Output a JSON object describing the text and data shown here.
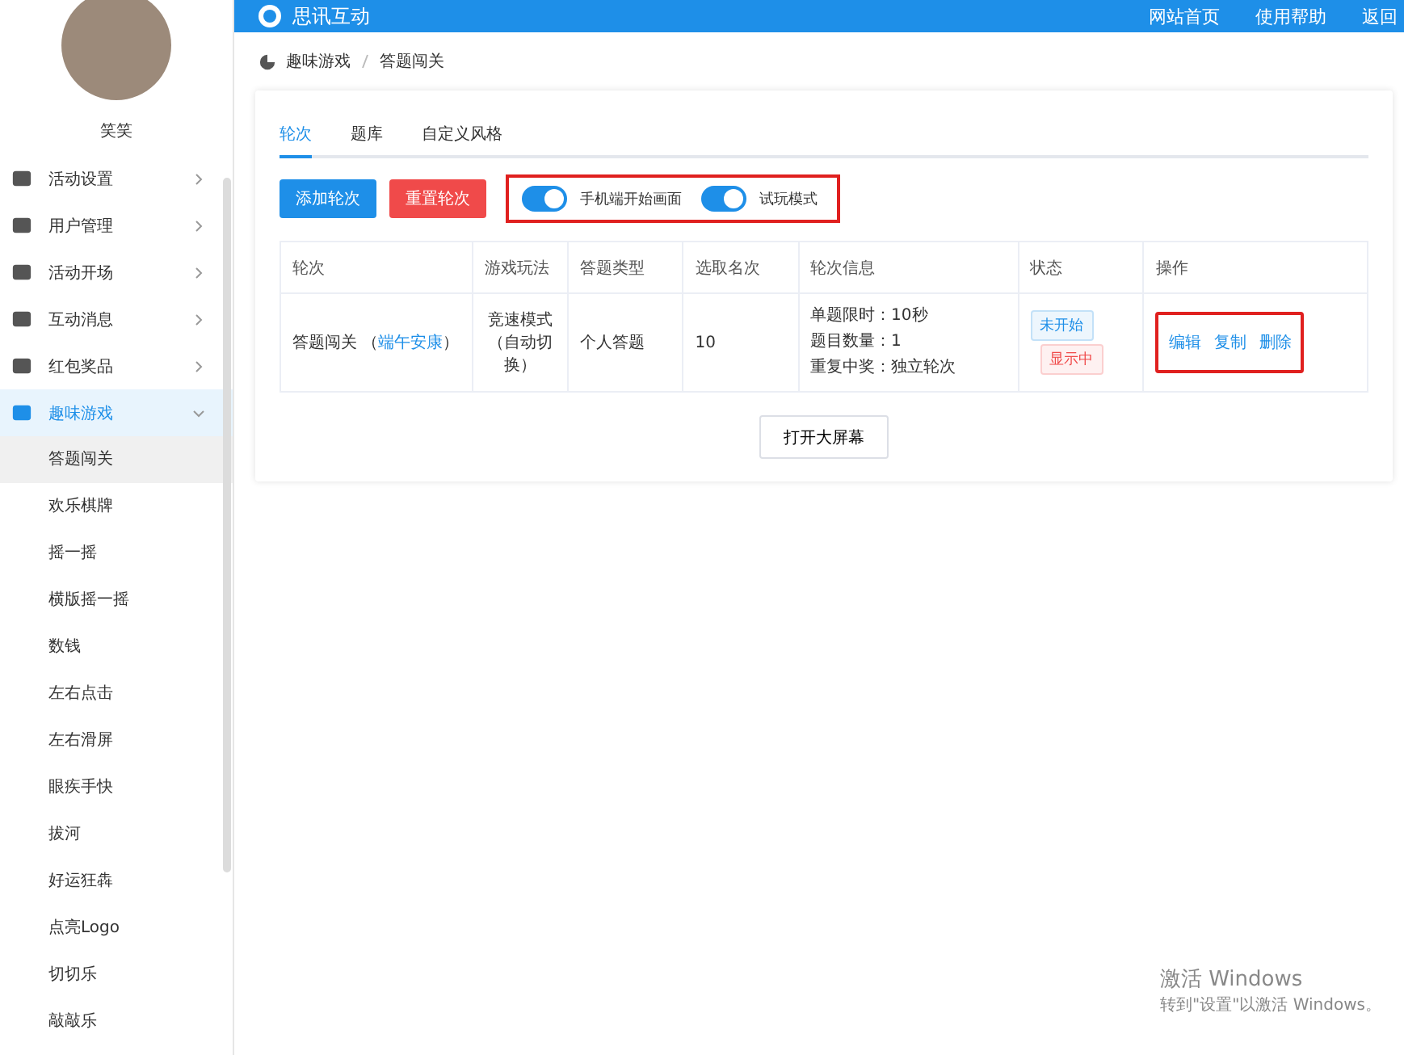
{
  "sidebar": {
    "user_name": "笑笑",
    "items": [
      {
        "label": "活动设置",
        "expanded": false,
        "selected": false
      },
      {
        "label": "用户管理",
        "expanded": false,
        "selected": false
      },
      {
        "label": "活动开场",
        "expanded": false,
        "selected": false
      },
      {
        "label": "互动消息",
        "expanded": false,
        "selected": false
      },
      {
        "label": "红包奖品",
        "expanded": false,
        "selected": false
      },
      {
        "label": "趣味游戏",
        "expanded": true,
        "selected": true,
        "children": [
          {
            "label": "答题闯关",
            "selected": true
          },
          {
            "label": "欢乐棋牌",
            "selected": false
          },
          {
            "label": "摇一摇",
            "selected": false
          },
          {
            "label": "横版摇一摇",
            "selected": false
          },
          {
            "label": "数钱",
            "selected": false
          },
          {
            "label": "左右点击",
            "selected": false
          },
          {
            "label": "左右滑屏",
            "selected": false
          },
          {
            "label": "眼疾手快",
            "selected": false
          },
          {
            "label": "拔河",
            "selected": false
          },
          {
            "label": "好运狂犇",
            "selected": false
          },
          {
            "label": "点亮Logo",
            "selected": false
          },
          {
            "label": "切切乐",
            "selected": false
          },
          {
            "label": "敲敲乐",
            "selected": false
          }
        ]
      }
    ]
  },
  "header": {
    "brand": "思讯互动",
    "links": [
      "网站首页",
      "使用帮助",
      "返回"
    ]
  },
  "breadcrumb": [
    "趣味游戏",
    "答题闯关"
  ],
  "tabs": [
    {
      "label": "轮次",
      "selected": true
    },
    {
      "label": "题库",
      "selected": false
    },
    {
      "label": "自定义风格",
      "selected": false
    }
  ],
  "toolbar": {
    "buttons": [
      {
        "label": "添加轮次",
        "kind": "primary"
      },
      {
        "label": "重置轮次",
        "kind": "danger"
      }
    ],
    "switches": [
      {
        "label": "手机端开始画面",
        "on": true
      },
      {
        "label": "试玩模式",
        "on": true
      }
    ]
  },
  "table": {
    "columns": [
      "轮次",
      "游戏玩法",
      "答题类型",
      "选取名次",
      "轮次信息",
      "状态",
      "操作"
    ],
    "rows": [
      {
        "round": "答题闯关 （",
        "round_link": "端午安康",
        "round_end": "）",
        "mode": "竞速模式（自动切换）",
        "type": "个人答题",
        "rank": "10",
        "info": [
          "单题限时：10秒",
          "题目数量：1",
          "重复中奖：独立轮次"
        ],
        "status": [
          {
            "label": "未开始",
            "color": "#1e8fe8"
          },
          {
            "label": "显示中",
            "color": "#f04a4a"
          }
        ],
        "actions": [
          "编辑",
          "复制",
          "删除"
        ]
      }
    ]
  },
  "screen_button": "打开大屏幕",
  "os_notice": {
    "title": "激活 Windows",
    "text": "转到\"设置\"以激活 Windows。"
  }
}
